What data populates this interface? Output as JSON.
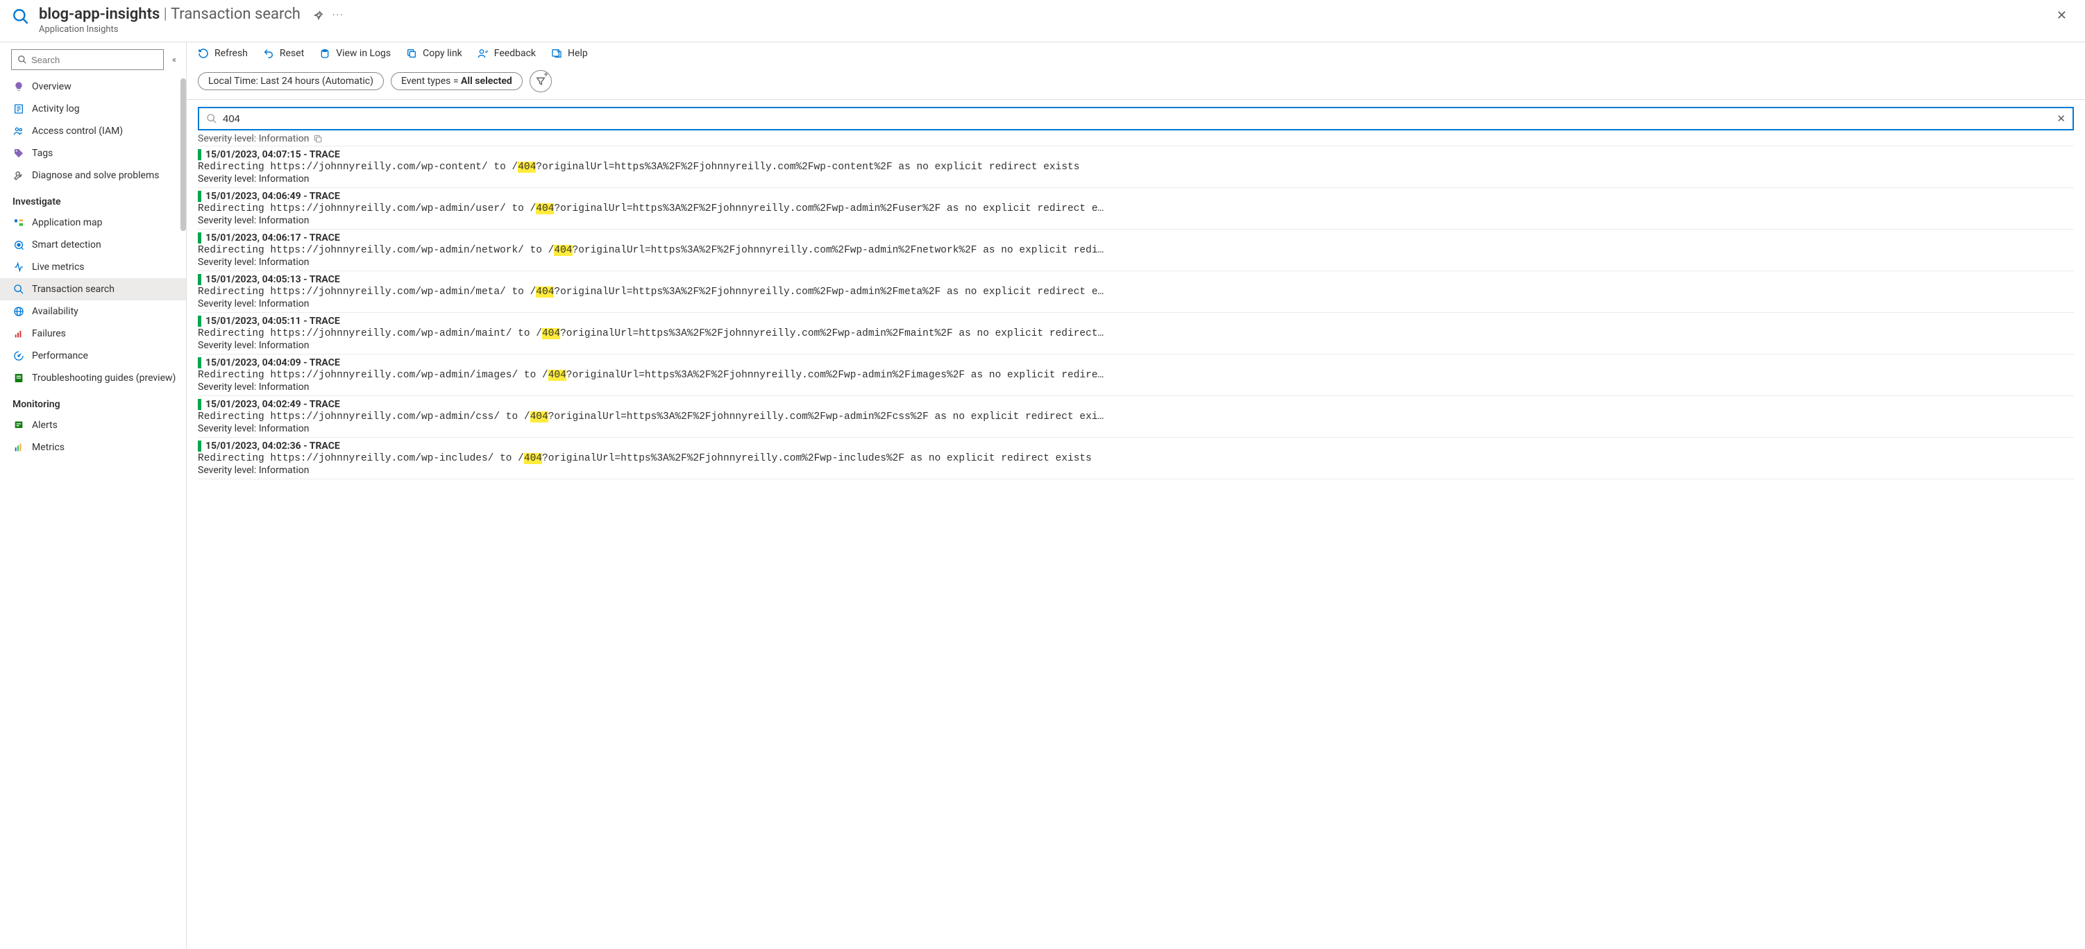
{
  "header": {
    "resource_name": "blog-app-insights",
    "page_name": "Transaction search",
    "subtitle": "Application Insights"
  },
  "sidebar": {
    "search_placeholder": "Search",
    "items": [
      {
        "label": "Overview",
        "icon": "bulb",
        "color": "#8764b8"
      },
      {
        "label": "Activity log",
        "icon": "log",
        "color": "#0078d4"
      },
      {
        "label": "Access control (IAM)",
        "icon": "people",
        "color": "#0078d4"
      },
      {
        "label": "Tags",
        "icon": "tag",
        "color": "#8764b8"
      },
      {
        "label": "Diagnose and solve problems",
        "icon": "wrench",
        "color": "#605e5c"
      }
    ],
    "investigate_label": "Investigate",
    "investigate": [
      {
        "label": "Application map",
        "icon": "appmap",
        "color": "#0078d4"
      },
      {
        "label": "Smart detection",
        "icon": "smart",
        "color": "#0078d4"
      },
      {
        "label": "Live metrics",
        "icon": "live",
        "color": "#0078d4"
      },
      {
        "label": "Transaction search",
        "icon": "search",
        "color": "#0078d4",
        "selected": true
      },
      {
        "label": "Availability",
        "icon": "globe",
        "color": "#0078d4"
      },
      {
        "label": "Failures",
        "icon": "failures",
        "color": "#d13438"
      },
      {
        "label": "Performance",
        "icon": "perf",
        "color": "#0078d4"
      },
      {
        "label": "Troubleshooting guides (preview)",
        "icon": "guide",
        "color": "#107c10"
      }
    ],
    "monitoring_label": "Monitoring",
    "monitoring": [
      {
        "label": "Alerts",
        "icon": "alert",
        "color": "#107c10"
      },
      {
        "label": "Metrics",
        "icon": "metrics",
        "color": "#0078d4"
      }
    ]
  },
  "toolbar": {
    "refresh": "Refresh",
    "reset": "Reset",
    "view_in_logs": "View in Logs",
    "copy_link": "Copy link",
    "feedback": "Feedback",
    "help": "Help"
  },
  "filters": {
    "time_range": "Local Time: Last 24 hours (Automatic)",
    "event_types_label": "Event types",
    "event_types_value": "All selected"
  },
  "search": {
    "value": "404"
  },
  "results": {
    "partial": {
      "text": "Severity level: Information"
    },
    "severity_label": "Severity level: Information",
    "entries": [
      {
        "timestamp": "15/01/2023, 04:07:15",
        "kind": "TRACE",
        "pre": "Redirecting https://johnnyreilly.com/wp-content/ to /",
        "hl": "404",
        "post": "?originalUrl=https%3A%2F%2Fjohnnyreilly.com%2Fwp-content%2F as no explicit redirect exists"
      },
      {
        "timestamp": "15/01/2023, 04:06:49",
        "kind": "TRACE",
        "pre": "Redirecting https://johnnyreilly.com/wp-admin/user/ to /",
        "hl": "404",
        "post": "?originalUrl=https%3A%2F%2Fjohnnyreilly.com%2Fwp-admin%2Fuser%2F as no explicit redirect e…"
      },
      {
        "timestamp": "15/01/2023, 04:06:17",
        "kind": "TRACE",
        "pre": "Redirecting https://johnnyreilly.com/wp-admin/network/ to /",
        "hl": "404",
        "post": "?originalUrl=https%3A%2F%2Fjohnnyreilly.com%2Fwp-admin%2Fnetwork%2F as no explicit redi…"
      },
      {
        "timestamp": "15/01/2023, 04:05:13",
        "kind": "TRACE",
        "pre": "Redirecting https://johnnyreilly.com/wp-admin/meta/ to /",
        "hl": "404",
        "post": "?originalUrl=https%3A%2F%2Fjohnnyreilly.com%2Fwp-admin%2Fmeta%2F as no explicit redirect e…"
      },
      {
        "timestamp": "15/01/2023, 04:05:11",
        "kind": "TRACE",
        "pre": "Redirecting https://johnnyreilly.com/wp-admin/maint/ to /",
        "hl": "404",
        "post": "?originalUrl=https%3A%2F%2Fjohnnyreilly.com%2Fwp-admin%2Fmaint%2F as no explicit redirect…"
      },
      {
        "timestamp": "15/01/2023, 04:04:09",
        "kind": "TRACE",
        "pre": "Redirecting https://johnnyreilly.com/wp-admin/images/ to /",
        "hl": "404",
        "post": "?originalUrl=https%3A%2F%2Fjohnnyreilly.com%2Fwp-admin%2Fimages%2F as no explicit redire…"
      },
      {
        "timestamp": "15/01/2023, 04:02:49",
        "kind": "TRACE",
        "pre": "Redirecting https://johnnyreilly.com/wp-admin/css/ to /",
        "hl": "404",
        "post": "?originalUrl=https%3A%2F%2Fjohnnyreilly.com%2Fwp-admin%2Fcss%2F as no explicit redirect exi…"
      },
      {
        "timestamp": "15/01/2023, 04:02:36",
        "kind": "TRACE",
        "pre": "Redirecting https://johnnyreilly.com/wp-includes/ to /",
        "hl": "404",
        "post": "?originalUrl=https%3A%2F%2Fjohnnyreilly.com%2Fwp-includes%2F as no explicit redirect exists"
      }
    ]
  }
}
